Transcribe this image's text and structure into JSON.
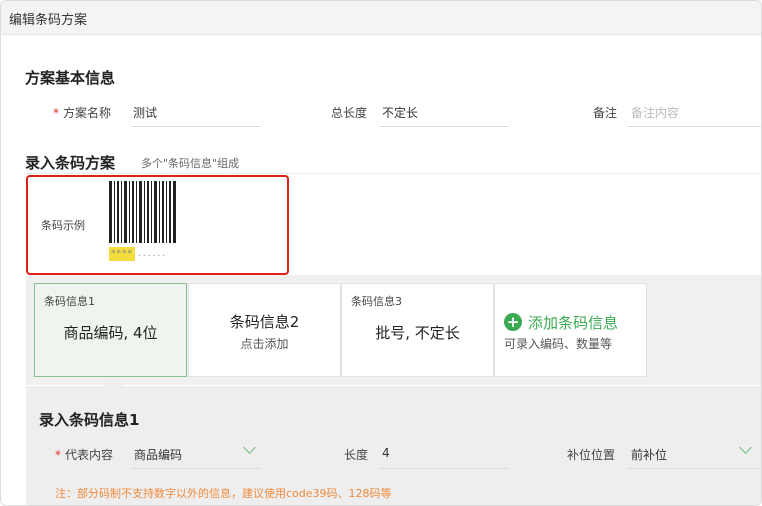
{
  "window": {
    "title": "编辑条码方案"
  },
  "basic_info": {
    "section_title": "方案基本信息",
    "required_mark": "*",
    "name_label": "方案名称",
    "name_value": "测试",
    "length_label": "总长度",
    "length_value": "不定长",
    "remark_label": "备注",
    "remark_placeholder": "备注内容"
  },
  "barcode_scheme": {
    "section_title": "录入条码方案",
    "hint": "多个\"条码信息\"组成",
    "sample_label": "条码示例",
    "sample_highlight": "****",
    "sample_dots": "......"
  },
  "cards": [
    {
      "small": "条码信息1",
      "big": "商品编码, 4位",
      "active": true
    },
    {
      "big": "条码信息2",
      "sub": "点击添加"
    },
    {
      "small": "条码信息3",
      "big": "批号, 不定长"
    }
  ],
  "add_card": {
    "icon": "plus-circle-icon",
    "title": "添加条码信息",
    "sub": "可录入编码、数量等"
  },
  "entry": {
    "section_title": "录入条码信息1",
    "required_mark": "*",
    "content_label": "代表内容",
    "content_value": "商品编码",
    "length_label": "长度",
    "length_value": "4",
    "pad_label": "补位位置",
    "pad_value": "前补位",
    "note": "注：部分码制不支持数字以外的信息，建议使用code39码、128码等"
  },
  "colors": {
    "accent_green": "#3aaa52",
    "highlight_red": "#e0211a",
    "note_orange": "#f08a3c"
  }
}
